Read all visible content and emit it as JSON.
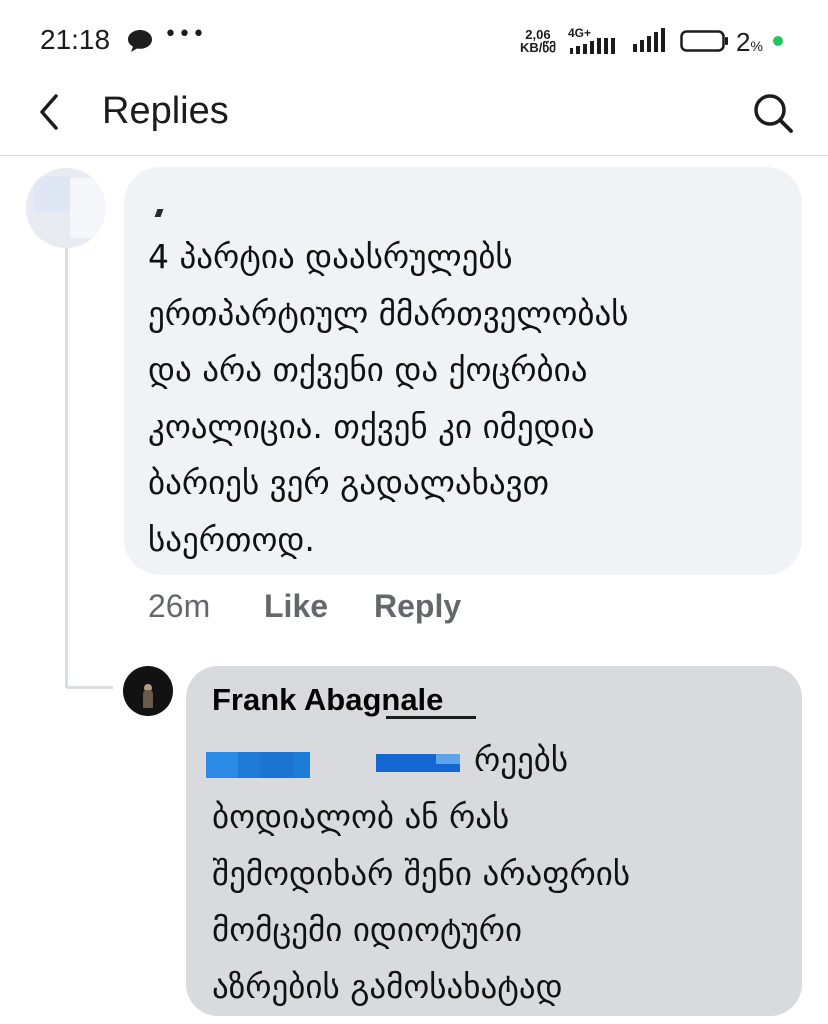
{
  "status_bar": {
    "time": "21:18",
    "net_speed_value": "2,06",
    "net_speed_unit": "KB/წმ",
    "network_type": "4G+",
    "battery_percent": "2",
    "battery_unit": "%",
    "icons": [
      "chat-bubble-icon",
      "more-dots-icon",
      "signal-icon",
      "battery-icon"
    ],
    "colors": {
      "battery_dot": "#22c55e"
    }
  },
  "header": {
    "title": "Replies",
    "back_icon": "back-arrow-icon",
    "search_icon": "search-icon"
  },
  "parent_comment": {
    "text": "4 პარტია დაასრულებს\nერთპარტიულ მმართველობას\nდა არა თქვენი და ქოცრბია\nკოალიცია. თქვენ კი იმედია\nბარიეს ვერ გადალახავთ\nსაერთოდ.",
    "time": "26m",
    "like_label": "Like",
    "reply_label": "Reply"
  },
  "reply_comment": {
    "author": "Frank Abagnale",
    "first_line_visible": "რეებს",
    "text": "ბოდიალობ ან რას\nშემოდიხარ შენი არაფრის\nმომცემი იდიოტური\nაზრების გამოსახატად"
  },
  "colors": {
    "bubble": "#f0f2f5",
    "reply_bubble": "#d8dade",
    "action_text": "#65676b",
    "redaction": "#1f7bd8"
  }
}
